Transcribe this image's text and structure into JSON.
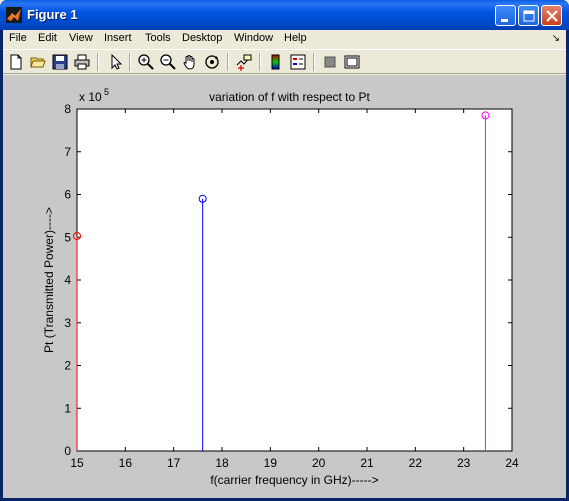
{
  "window": {
    "title": "Figure 1",
    "buttons": [
      "minimize",
      "maximize",
      "close"
    ]
  },
  "menubar": {
    "items": [
      {
        "label": "File"
      },
      {
        "label": "Edit"
      },
      {
        "label": "View"
      },
      {
        "label": "Insert"
      },
      {
        "label": "Tools"
      },
      {
        "label": "Desktop"
      },
      {
        "label": "Window"
      },
      {
        "label": "Help"
      }
    ]
  },
  "toolbar": {
    "tools": [
      "new-figure-icon",
      "open-file-icon",
      "save-icon",
      "print-icon",
      "pointer-icon",
      "zoom-in-icon",
      "zoom-out-icon",
      "pan-hand-icon",
      "rotate-3d-icon",
      "data-cursor-icon",
      "colorbar-icon",
      "legend-icon",
      "hide-plot-tools-icon",
      "show-plot-tools-icon"
    ]
  },
  "figure_bg": "#C8C8C8",
  "chart_data": {
    "type": "stem",
    "title": "variation of f with respect to Pt",
    "xlabel": "f(carrier frequency in GHz)----->",
    "ylabel": "Pt (Transmitted Power)---->",
    "exponent_label": "x 10",
    "exponent_power": "5",
    "xlim": [
      15,
      24
    ],
    "ylim": [
      0,
      8
    ],
    "x_ticks": [
      "15",
      "16",
      "17",
      "18",
      "19",
      "20",
      "21",
      "22",
      "23",
      "24"
    ],
    "y_ticks": [
      "0",
      "1",
      "2",
      "3",
      "4",
      "5",
      "6",
      "7",
      "8"
    ],
    "series": [
      {
        "x": 15.0,
        "y": 5.03,
        "color": "#FF0000"
      },
      {
        "x": 17.6,
        "y": 5.9,
        "color": "#0000FF"
      },
      {
        "x": 23.45,
        "y": 7.85,
        "color": "#FF00FF"
      }
    ]
  }
}
